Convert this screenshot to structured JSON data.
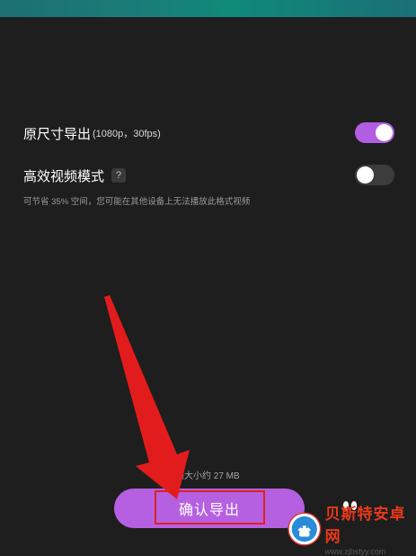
{
  "settings": {
    "original_size_export": {
      "label": "原尺寸导出",
      "detail": "(1080p，30fps)",
      "enabled": true
    },
    "efficient_video_mode": {
      "label": "高效视频模式",
      "help_icon": "?",
      "enabled": false,
      "hint": "可节省 35% 空间，您可能在其他设备上无法播放此格式视频"
    }
  },
  "footer": {
    "size_estimate": "频大小约 27 MB",
    "confirm_export_label": "确认导出"
  },
  "watermark": {
    "title": "贝斯特安卓网",
    "url": "www.zjbstyy.com"
  },
  "colors": {
    "accent": "#b25ee2",
    "annotation_red": "#e02020",
    "background": "#1e1e1e"
  },
  "icons": [
    "help-icon",
    "share-icon",
    "annotation-arrow",
    "watermark-logo-icon"
  ]
}
